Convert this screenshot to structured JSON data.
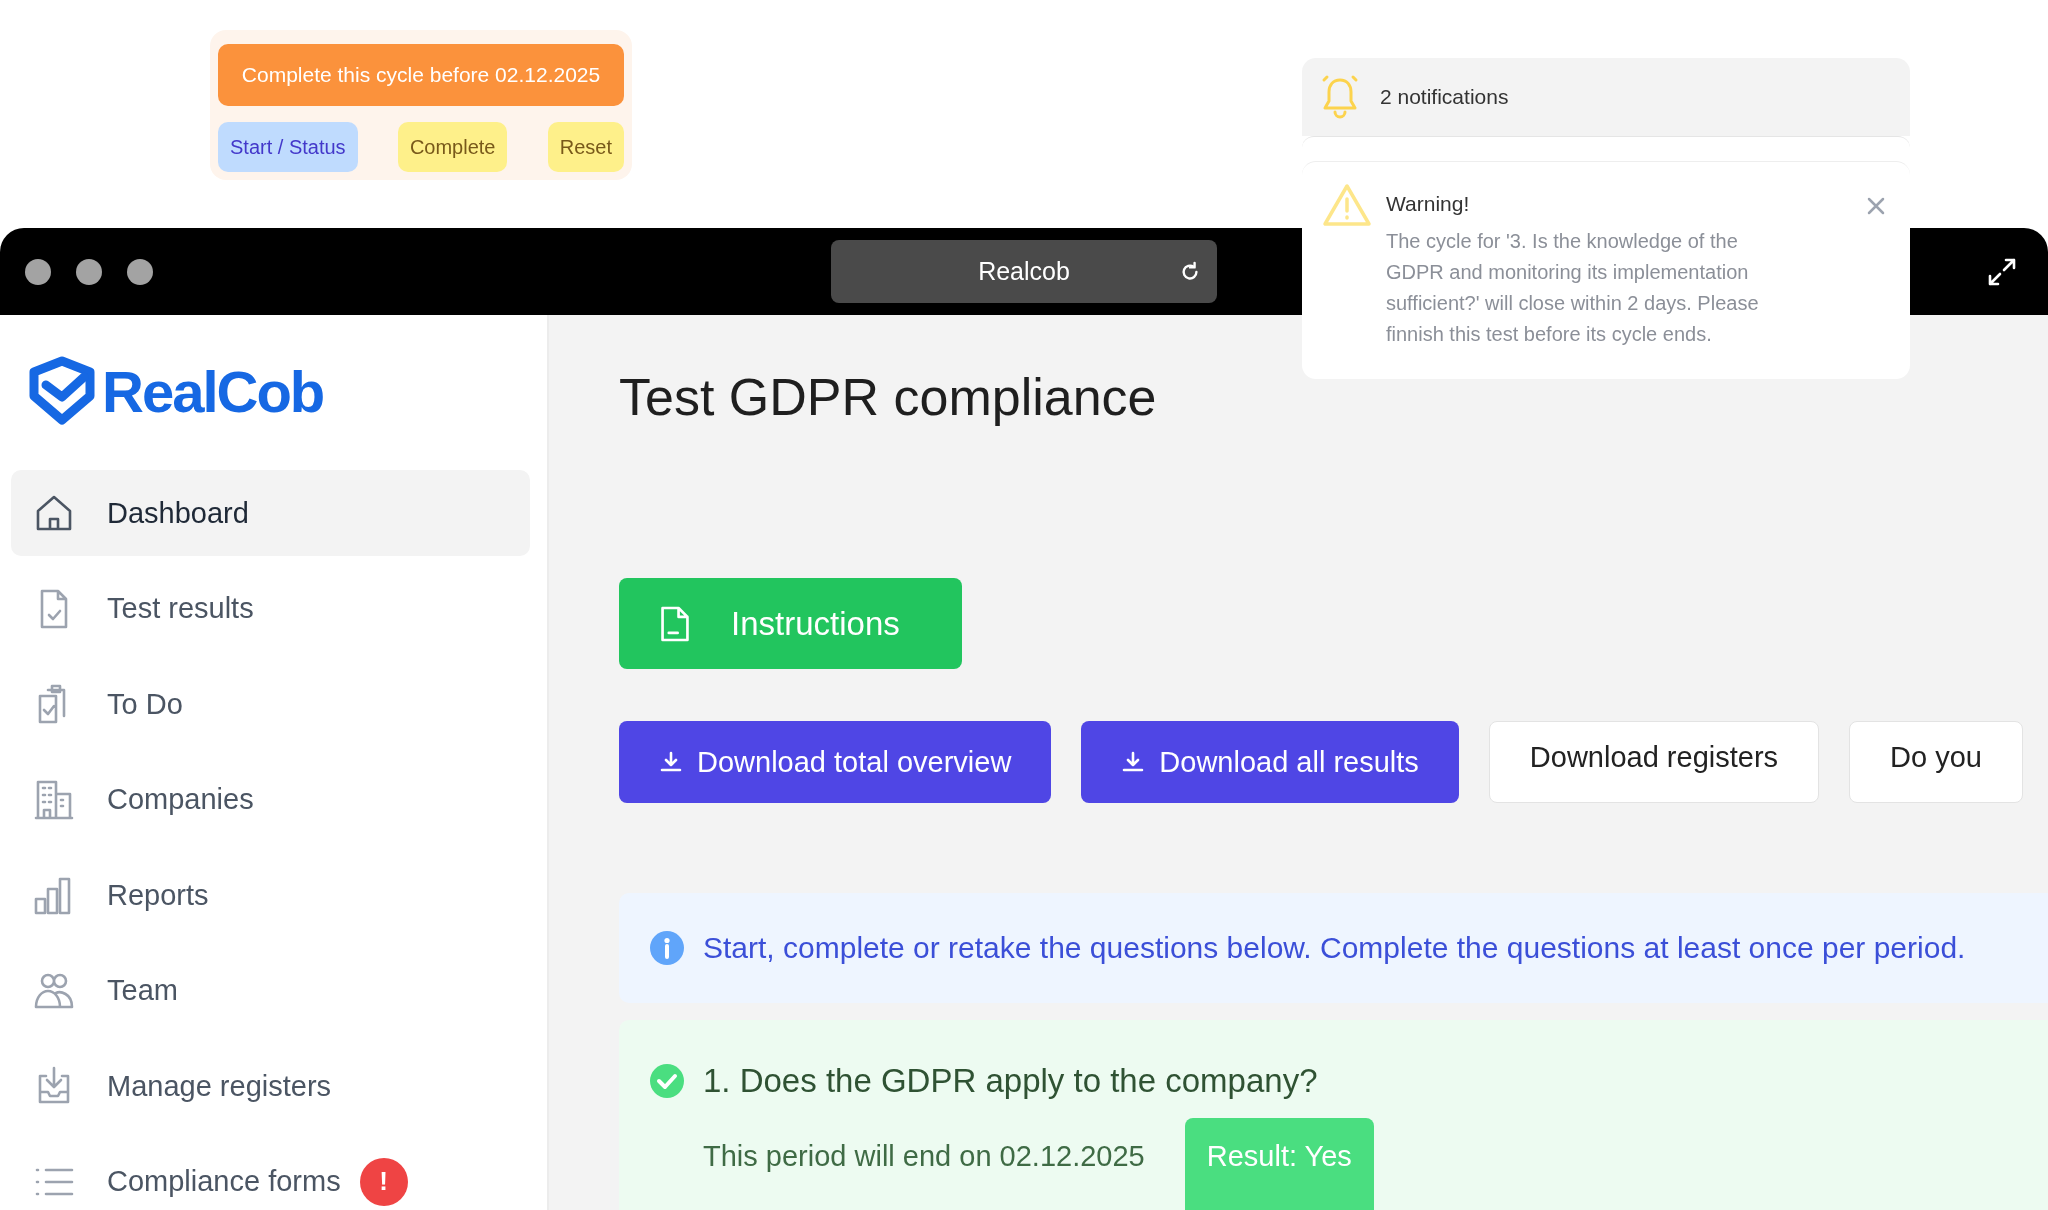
{
  "cycle_callout": {
    "banner": "Complete this cycle before 02.12.2025",
    "buttons": [
      {
        "label": "Start / Status",
        "kind": "status"
      },
      {
        "label": "Complete",
        "kind": "action"
      },
      {
        "label": "Reset",
        "kind": "action"
      }
    ]
  },
  "notifications": {
    "count_label": "2 notifications",
    "warning": {
      "title": "Warning!",
      "message": "The cycle for '3. Is the knowledge of the GDPR and monitoring its implementation sufficient?' will close within 2 days. Please finnish this test before its cycle ends."
    }
  },
  "browser": {
    "address": "Realcob"
  },
  "sidebar": {
    "logo": "RealCob",
    "items": [
      {
        "label": "Dashboard",
        "kind": "home",
        "selected": true
      },
      {
        "label": "Test results",
        "kind": "document-check",
        "selected": false
      },
      {
        "label": "To Do",
        "kind": "clipboards",
        "selected": false
      },
      {
        "label": "Companies",
        "kind": "building",
        "selected": false
      },
      {
        "label": "Reports",
        "kind": "bars",
        "selected": false
      },
      {
        "label": "Team",
        "kind": "people",
        "selected": false
      },
      {
        "label": "Manage registers",
        "kind": "tray-download",
        "selected": false
      },
      {
        "label": "Compliance forms",
        "kind": "list",
        "selected": false,
        "badge": "!"
      }
    ]
  },
  "page": {
    "title": "Test GDPR compliance",
    "instructions_button": "Instructions",
    "actions": [
      {
        "label": "Download total overview",
        "kind": "primary"
      },
      {
        "label": "Download all results",
        "kind": "primary"
      },
      {
        "label": "Download registers",
        "kind": "secondary"
      },
      {
        "label": "Do you",
        "kind": "secondary"
      }
    ],
    "info": "Start, complete or retake the questions below. Complete the questions at least once per period.",
    "questions": [
      {
        "title": "1. Does the GDPR apply to the company?",
        "completed": true,
        "period": "This period will end on 02.12.2025",
        "result": "Result: Yes"
      }
    ]
  }
}
